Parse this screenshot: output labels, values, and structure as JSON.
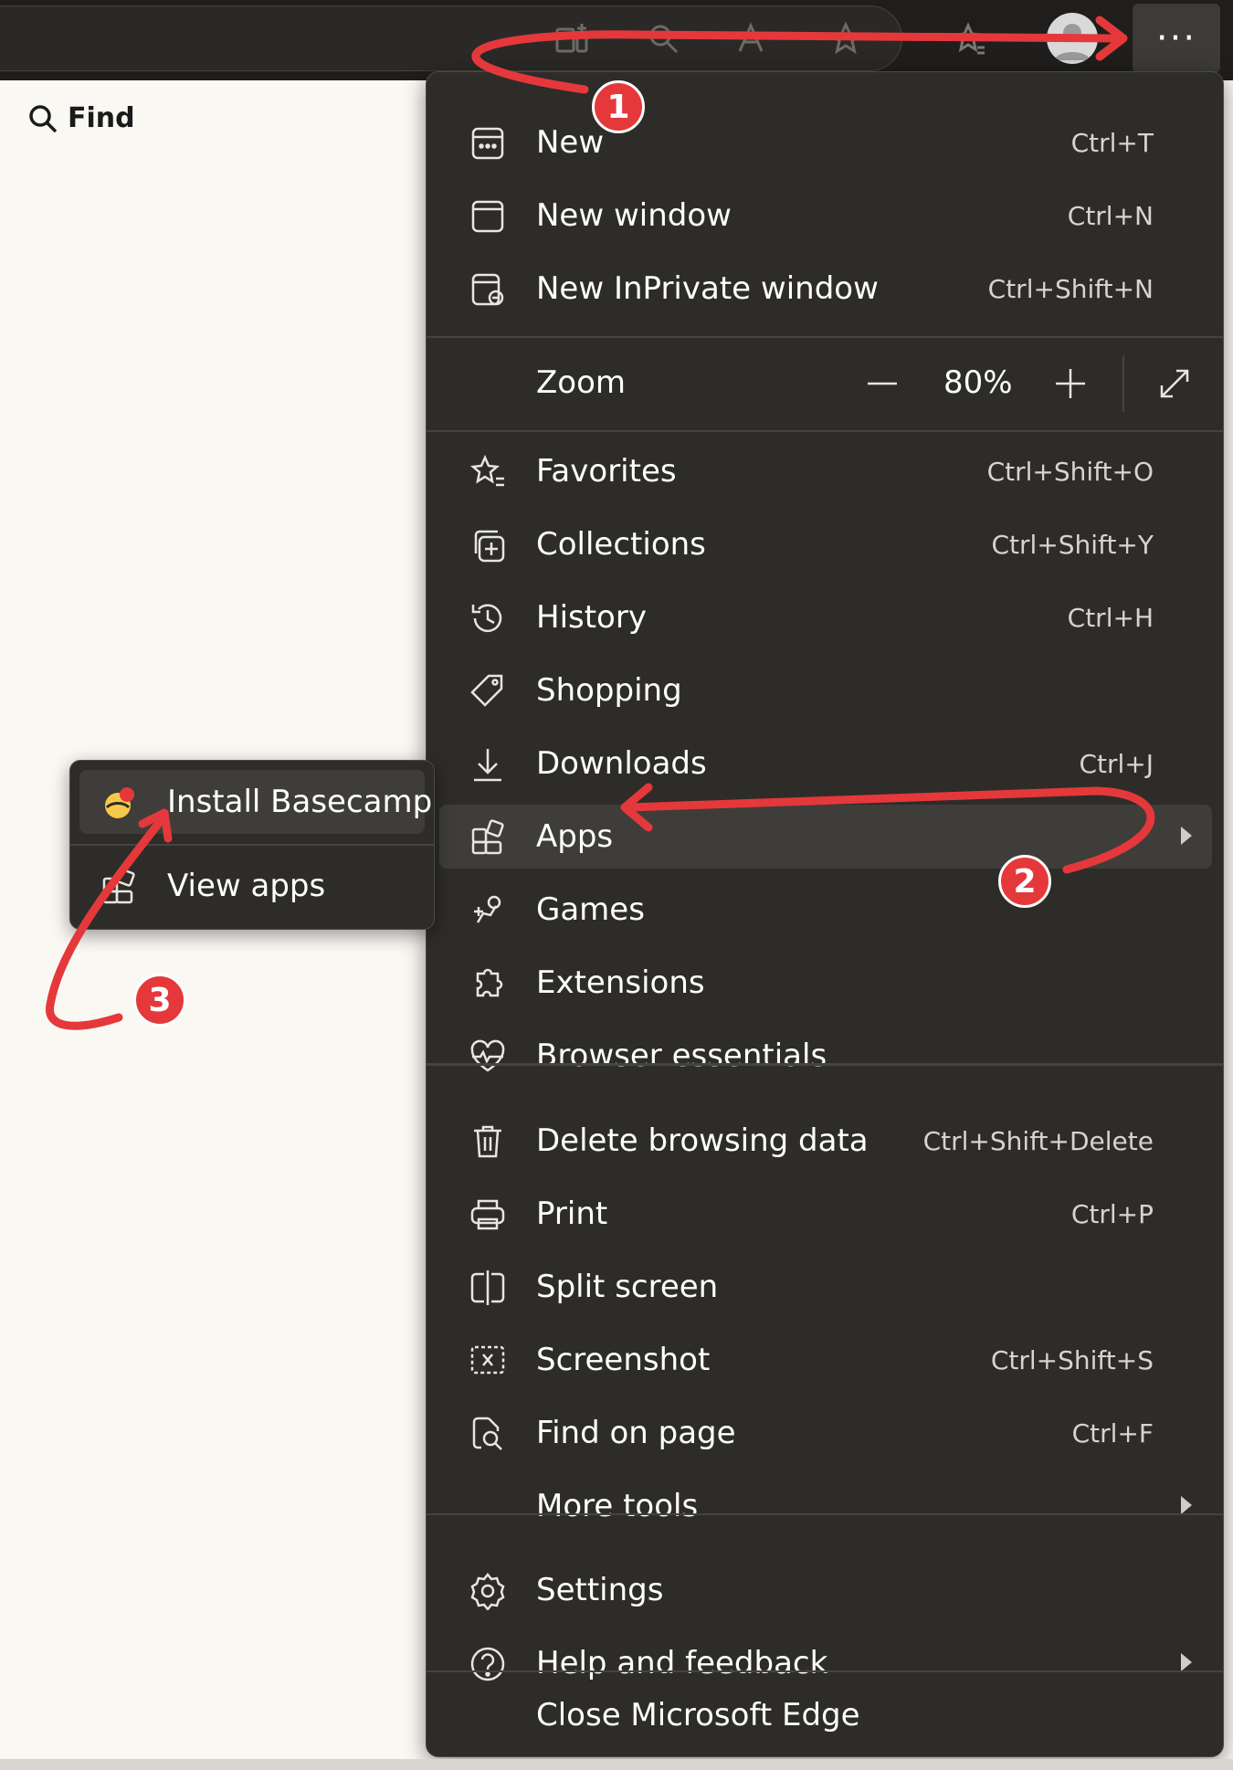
{
  "find_label": "Find",
  "more_button_label": "···",
  "menu": {
    "items_top": [
      {
        "label": "New",
        "shortcut": "Ctrl+T"
      },
      {
        "label": "New window",
        "shortcut": "Ctrl+N"
      },
      {
        "label": "New InPrivate window",
        "shortcut": "Ctrl+Shift+N"
      }
    ],
    "zoom": {
      "label": "Zoom",
      "value": "80%"
    },
    "items_mid": [
      {
        "label": "Favorites",
        "shortcut": "Ctrl+Shift+O"
      },
      {
        "label": "Collections",
        "shortcut": "Ctrl+Shift+Y"
      },
      {
        "label": "History",
        "shortcut": "Ctrl+H"
      },
      {
        "label": "Shopping",
        "shortcut": ""
      },
      {
        "label": "Downloads",
        "shortcut": "Ctrl+J"
      },
      {
        "label": "Apps",
        "shortcut": ""
      },
      {
        "label": "Games",
        "shortcut": ""
      },
      {
        "label": "Extensions",
        "shortcut": ""
      },
      {
        "label": "Browser essentials",
        "shortcut": ""
      }
    ],
    "items_low": [
      {
        "label": "Delete browsing data",
        "shortcut": "Ctrl+Shift+Delete"
      },
      {
        "label": "Print",
        "shortcut": "Ctrl+P"
      },
      {
        "label": "Split screen",
        "shortcut": ""
      },
      {
        "label": "Screenshot",
        "shortcut": "Ctrl+Shift+S"
      },
      {
        "label": "Find on page",
        "shortcut": "Ctrl+F"
      },
      {
        "label": "More tools",
        "shortcut": ""
      }
    ],
    "items_bottom": [
      {
        "label": "Settings"
      },
      {
        "label": "Help and feedback"
      }
    ],
    "close_label": "Close Microsoft Edge"
  },
  "submenu": {
    "install_label": "Install Basecamp",
    "view_label": "View apps"
  },
  "annotations": {
    "step1": "1",
    "step2": "2",
    "step3": "3"
  },
  "colors": {
    "menu_bg": "#2d2c29",
    "accent_red": "#e5383b",
    "page_bg": "#faf8f3"
  }
}
